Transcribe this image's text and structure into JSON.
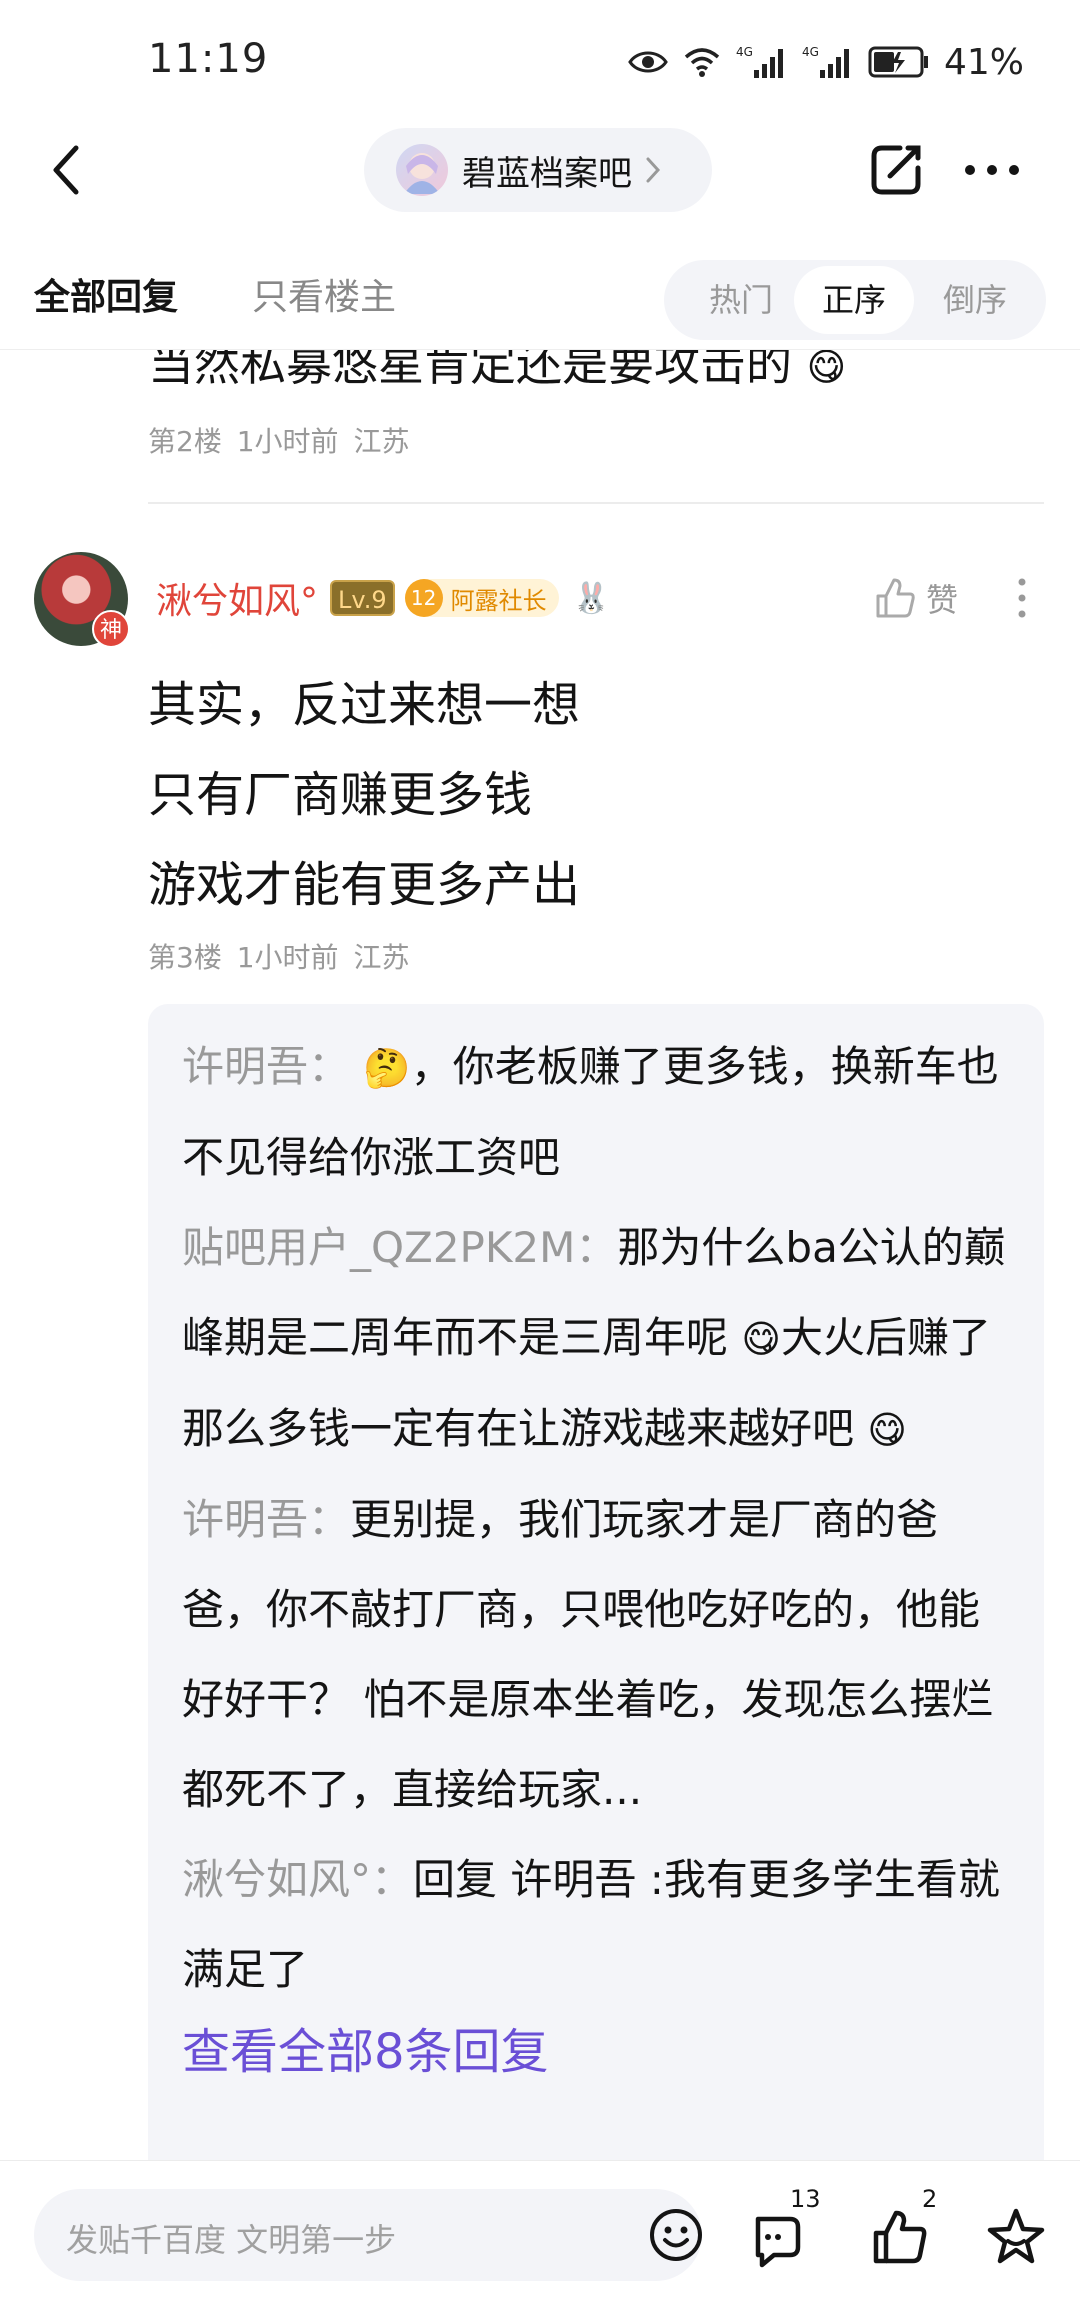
{
  "status_bar": {
    "time": "11:19",
    "network_1": "4G",
    "network_2": "4G",
    "battery": "41%",
    "icons": [
      "eye-icon",
      "wifi-icon",
      "signal-icon",
      "signal-icon",
      "battery-icon"
    ]
  },
  "nav": {
    "forum_name": "碧蓝档案吧",
    "icons": [
      "back-arrow-icon",
      "chevron-right-icon",
      "edit-icon",
      "more-dots-icon"
    ]
  },
  "tabs": {
    "all_replies": "全部回复",
    "op_only": "只看楼主",
    "sort": {
      "hot": "热门",
      "asc": "正序",
      "desc": "倒序",
      "selected": "正序"
    }
  },
  "previous_floor": {
    "text": "当然私募悠星肯定还是要攻击的",
    "emoji": "😋",
    "floor": "第2楼",
    "time": "1小时前",
    "location": "江苏"
  },
  "floor3": {
    "avatar_badge": "神",
    "username": "湫兮如风°",
    "level": "Lv.9",
    "title_level": "12",
    "title": "阿露社长",
    "like_label": "赞",
    "lines": [
      "其实，反过来想一想",
      "只有厂商赚更多钱",
      "游戏才能有更多产出"
    ],
    "floor": "第3楼",
    "time": "1小时前",
    "location": "江苏",
    "replies": [
      {
        "name": "许明吾",
        "sep": "：",
        "emoji": "🤔",
        "text": "，你老板赚了更多钱，换新车也不见得给你涨工资吧"
      },
      {
        "name": "贴吧用户_QZ2PK2M",
        "sep": "：",
        "text_a": "那为什么ba公认的巅峰期是二周年而不是三周年呢",
        "emoji_a": "😋",
        "text_b": "大火后赚了那么多钱一定有在让游戏越来越好吧",
        "emoji_b": "😋"
      },
      {
        "name": "许明吾",
        "sep": "：",
        "text": "更别提，我们玩家才是厂商的爸爸，你不敲打厂商，只喂他吃好吃的，他能好好干？ 怕不是原本坐着吃，发现怎么摆烂都死不了，直接给玩家..."
      },
      {
        "name": "湫兮如风°",
        "sep": "：",
        "text": "回复 许明吾 :我有更多学生看就满足了"
      }
    ],
    "view_all": "查看全部8条回复"
  },
  "bottom_bar": {
    "input_placeholder": "发贴千百度 文明第一步",
    "comment_count": "13",
    "like_count": "2"
  }
}
